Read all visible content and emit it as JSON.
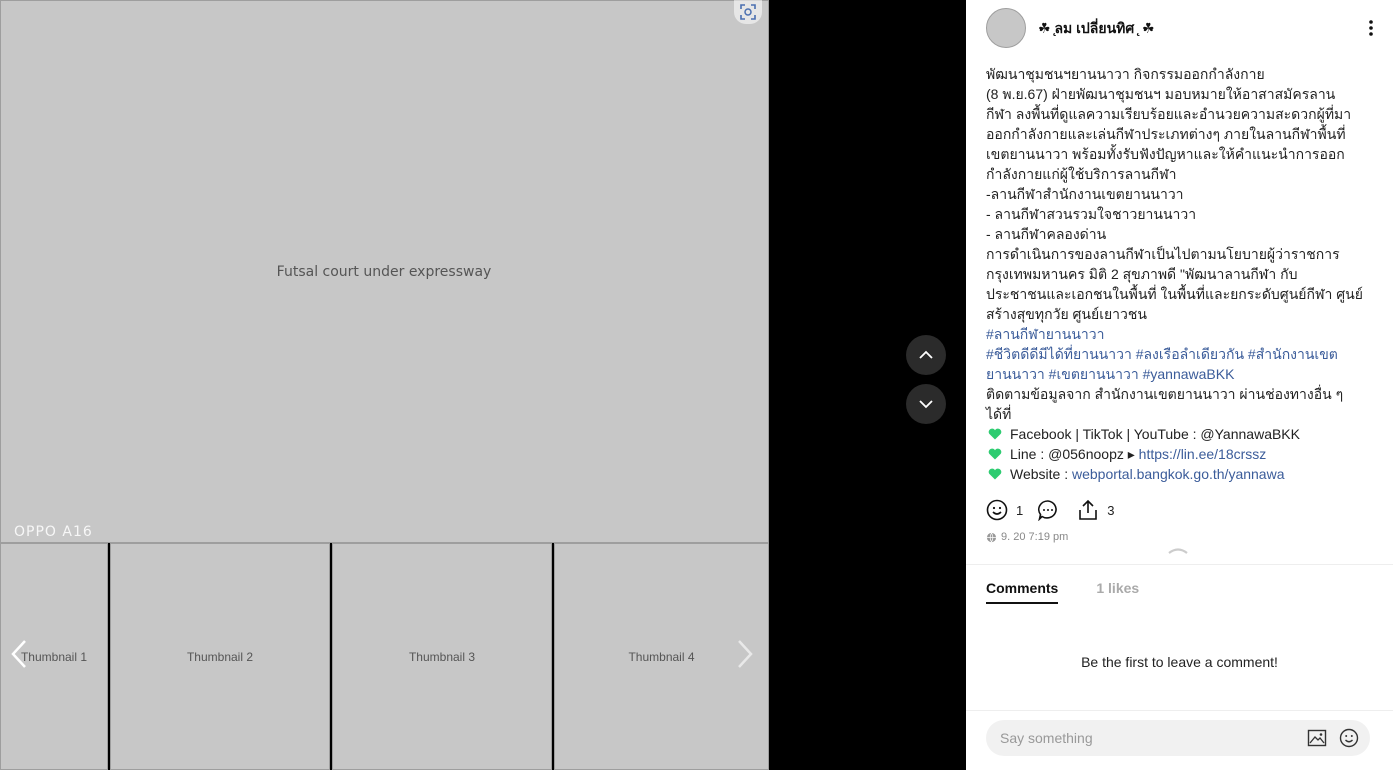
{
  "viewer": {
    "main_photo_watermark": "OPPO A16",
    "main_photo_label": "Futsal court under expressway",
    "thumbnails": [
      "Thumbnail 1",
      "Thumbnail 2",
      "Thumbnail 3",
      "Thumbnail 4"
    ],
    "prev_glyph": "❮",
    "next_glyph": "❯"
  },
  "post": {
    "author": "☘ ̨ลม เปลี่ยนทิศ ̨ ☘",
    "caption_lines": [
      {
        "type": "text",
        "text": "พัฒนาชุมชนฯยานนาวา กิจกรรมออกกำลังกาย"
      },
      {
        "type": "text",
        "text": " (8 พ.ย.67)  ฝ่ายพัฒนาชุมชนฯ มอบหมายให้อาสาสมัครลาน"
      },
      {
        "type": "text",
        "text": "กีฬา ลงพื้นที่ดูแลความเรียบร้อยและอำนวยความสะดวกผู้ที่มา"
      },
      {
        "type": "text",
        "text": "ออกกำลังกายและเล่นกีฬาประเภทต่างๆ ภายในลานกีฬาพื้นที่"
      },
      {
        "type": "text",
        "text": "เขตยานนาวา พร้อมทั้งรับฟังปัญหาและให้คำแนะนำการออก"
      },
      {
        "type": "text",
        "text": "กำลังกายแก่ผู้ใช้บริการลานกีฬา"
      },
      {
        "type": "text",
        "text": "-ลานกีฬาสำนักงานเขตยานนาวา"
      },
      {
        "type": "text",
        "text": "- ลานกีฬาสวนรวมใจชาวยานนาวา"
      },
      {
        "type": "text",
        "text": "- ลานกีฬาคลองด่าน"
      },
      {
        "type": "text",
        "text": "   การดำเนินการของลานกีฬาเป็นไปตามนโยบายผู้ว่าราชการ"
      },
      {
        "type": "text",
        "text": "กรุงเทพมหานคร  มิติ 2 สุขภาพดี  \"พัฒนาลานกีฬา กับ"
      },
      {
        "type": "text",
        "text": "ประชาชนและเอกชนในพื้นที่ ในพื้นที่และยกระดับศูนย์กีฬา ศูนย์"
      },
      {
        "type": "text",
        "text": "สร้างสุขทุกวัย ศูนย์เยาวชน"
      },
      {
        "type": "tag",
        "text": "#ลานกีฬายานนาวา"
      },
      {
        "type": "tag",
        "text": "#ชีวิตดีดีมีได้ที่ยานนาวา #ลงเรือลำเดียวกัน #สำนักงานเขต"
      },
      {
        "type": "tag",
        "text": "ยานนาวา #เขตยานนาวา #yannawaBKK"
      },
      {
        "type": "text",
        "text": "ติดตามข้อมูลจาก สำนักงานเขตยานนาวา ผ่านช่องทางอื่น ๆ"
      },
      {
        "type": "text",
        "text": "ได้ที่"
      }
    ],
    "contacts": {
      "facebook": "Facebook | TikTok | YouTube : @YannawaBKK",
      "line_prefix": "Line : @056noopz ",
      "line_arrow": "▸",
      "line_url": "https://lin.ee/18crssz",
      "website_prefix": "Website : ",
      "website_url": "webportal.bangkok.go.th/yannawa"
    },
    "reactions_count": "1",
    "shares_count": "3",
    "timestamp": "9. 20 7:19 pm",
    "heart_color": "#2ecc71"
  },
  "comments": {
    "tab_comments": "Comments",
    "tab_likes": "1 likes",
    "empty_text": "Be the first to leave a comment!",
    "input_placeholder": "Say something"
  }
}
